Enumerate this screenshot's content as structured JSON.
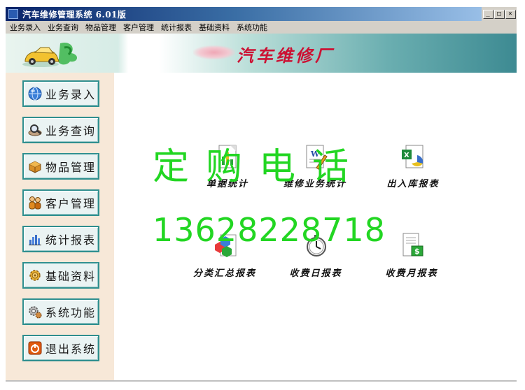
{
  "window": {
    "title": "汽车维修管理系统  6.01版",
    "controls": [
      "_",
      "□",
      "×"
    ]
  },
  "menu": [
    "业务录入",
    "业务查询",
    "物品管理",
    "客户管理",
    "统计报表",
    "基础资料",
    "系统功能"
  ],
  "header": {
    "app_name": "汽车维修厂"
  },
  "sidebar": {
    "items": [
      {
        "label": "业务录入",
        "icon": "globe-icon"
      },
      {
        "label": "业务查询",
        "icon": "magnifier-icon"
      },
      {
        "label": "物品管理",
        "icon": "box-icon"
      },
      {
        "label": "客户管理",
        "icon": "people-icon"
      },
      {
        "label": "统计报表",
        "icon": "bar-chart-icon"
      },
      {
        "label": "基础资料",
        "icon": "settings-icon"
      },
      {
        "label": "系统功能",
        "icon": "gear-icon"
      },
      {
        "label": "退出系统",
        "icon": "power-icon"
      }
    ]
  },
  "functions": [
    {
      "label": "单据统计",
      "icon": "document-chart-icon"
    },
    {
      "label": "维修业务统计",
      "icon": "word-document-icon"
    },
    {
      "label": "出入库报表",
      "icon": "excel-chart-icon"
    },
    {
      "label": "分类汇总报表",
      "icon": "cubes-icon"
    },
    {
      "label": "收费日报表",
      "icon": "clock-icon"
    },
    {
      "label": "收费月报表",
      "icon": "money-report-icon"
    }
  ],
  "watermark": {
    "line1": "定购电话",
    "line2": "13628228718"
  },
  "colors": {
    "titlebar": "#0a246a",
    "menubar": "#d4d0c8",
    "sidebar": "#f7e8d8",
    "nav_border": "#2f8f8f",
    "app_name": "#cc1133",
    "watermark": "#22d622"
  }
}
